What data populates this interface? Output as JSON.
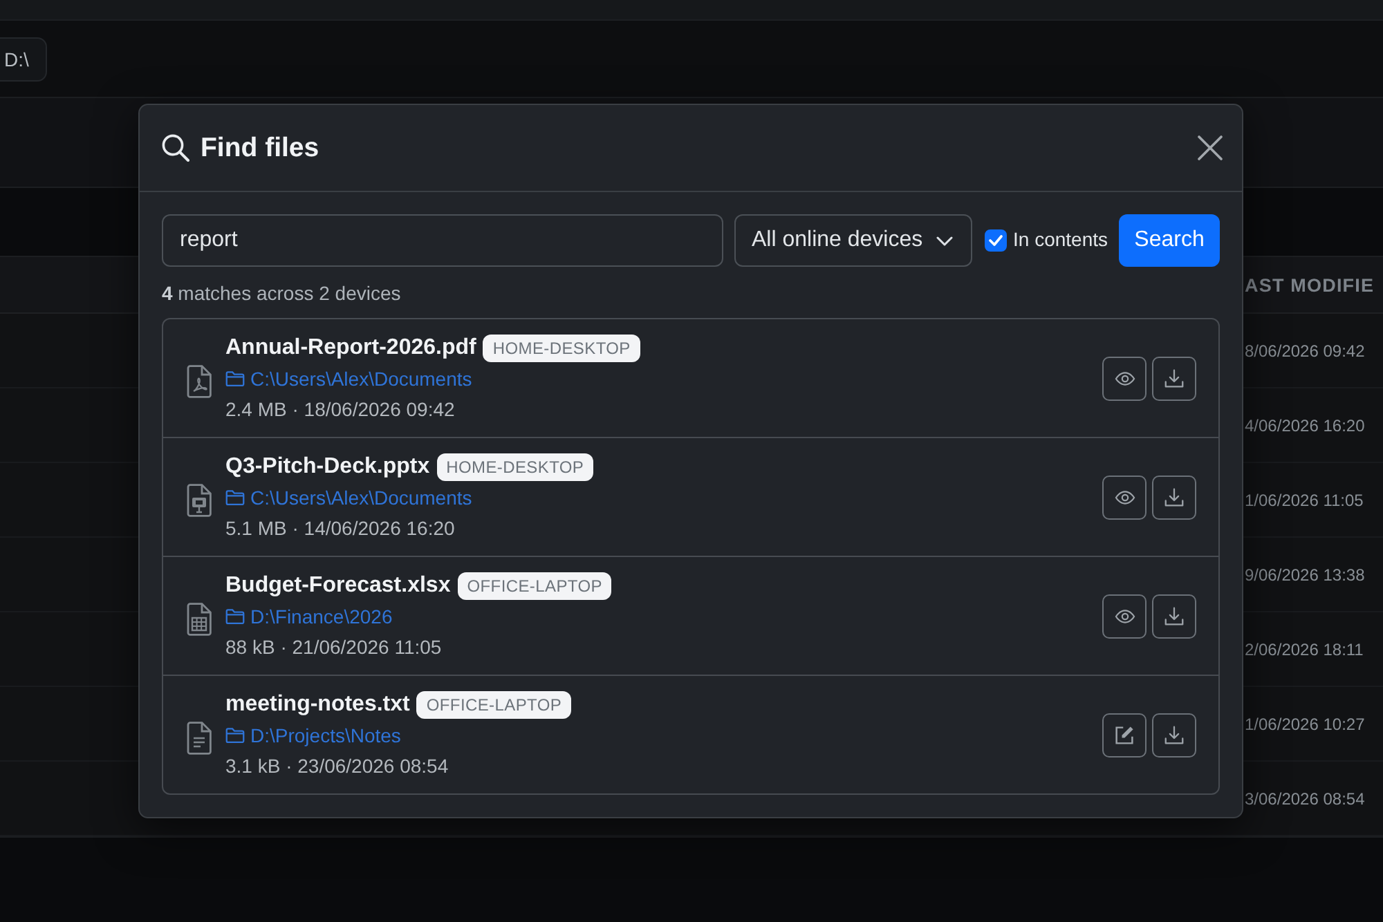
{
  "background": {
    "drive_chip": "D:\\",
    "table": {
      "column_header": "AST MODIFIE",
      "rows": [
        "8/06/2026 09:42",
        "4/06/2026 16:20",
        "1/06/2026 11:05",
        "9/06/2026 13:38",
        "2/06/2026 18:11",
        "1/06/2026 10:27",
        "3/06/2026 08:54"
      ]
    }
  },
  "dialog": {
    "title": "Find files",
    "search": {
      "value": "report"
    },
    "device_filter": {
      "value": "All online devices"
    },
    "in_contents": {
      "label": "In contents",
      "checked": true
    },
    "search_button": "Search",
    "summary": "**4** matches across 2 devices",
    "results": [
      {
        "kind": "pdf",
        "name": "Annual-Report-2026.pdf",
        "device": "HOME-DESKTOP",
        "path": "C:\\Users\\Alex\\Documents",
        "meta": "2.4 MB · 18/06/2026 09:42",
        "actions": [
          {
            "kind": "preview"
          },
          {
            "kind": "download"
          }
        ]
      },
      {
        "kind": "slides",
        "name": "Q3-Pitch-Deck.pptx",
        "device": "HOME-DESKTOP",
        "path": "C:\\Users\\Alex\\Documents",
        "meta": "5.1 MB · 14/06/2026 16:20",
        "actions": [
          {
            "kind": "preview"
          },
          {
            "kind": "download"
          }
        ]
      },
      {
        "kind": "sheet",
        "name": "Budget-Forecast.xlsx",
        "device": "OFFICE-LAPTOP",
        "path": "D:\\Finance\\2026",
        "meta": "88 kB · 21/06/2026 11:05",
        "actions": [
          {
            "kind": "preview"
          },
          {
            "kind": "download"
          }
        ]
      },
      {
        "kind": "text",
        "name": "meeting-notes.txt",
        "device": "OFFICE-LAPTOP",
        "path": "D:\\Projects\\Notes",
        "meta": "3.1 kB · 23/06/2026 08:54",
        "actions": [
          {
            "kind": "edit"
          },
          {
            "kind": "download"
          }
        ]
      }
    ]
  }
}
